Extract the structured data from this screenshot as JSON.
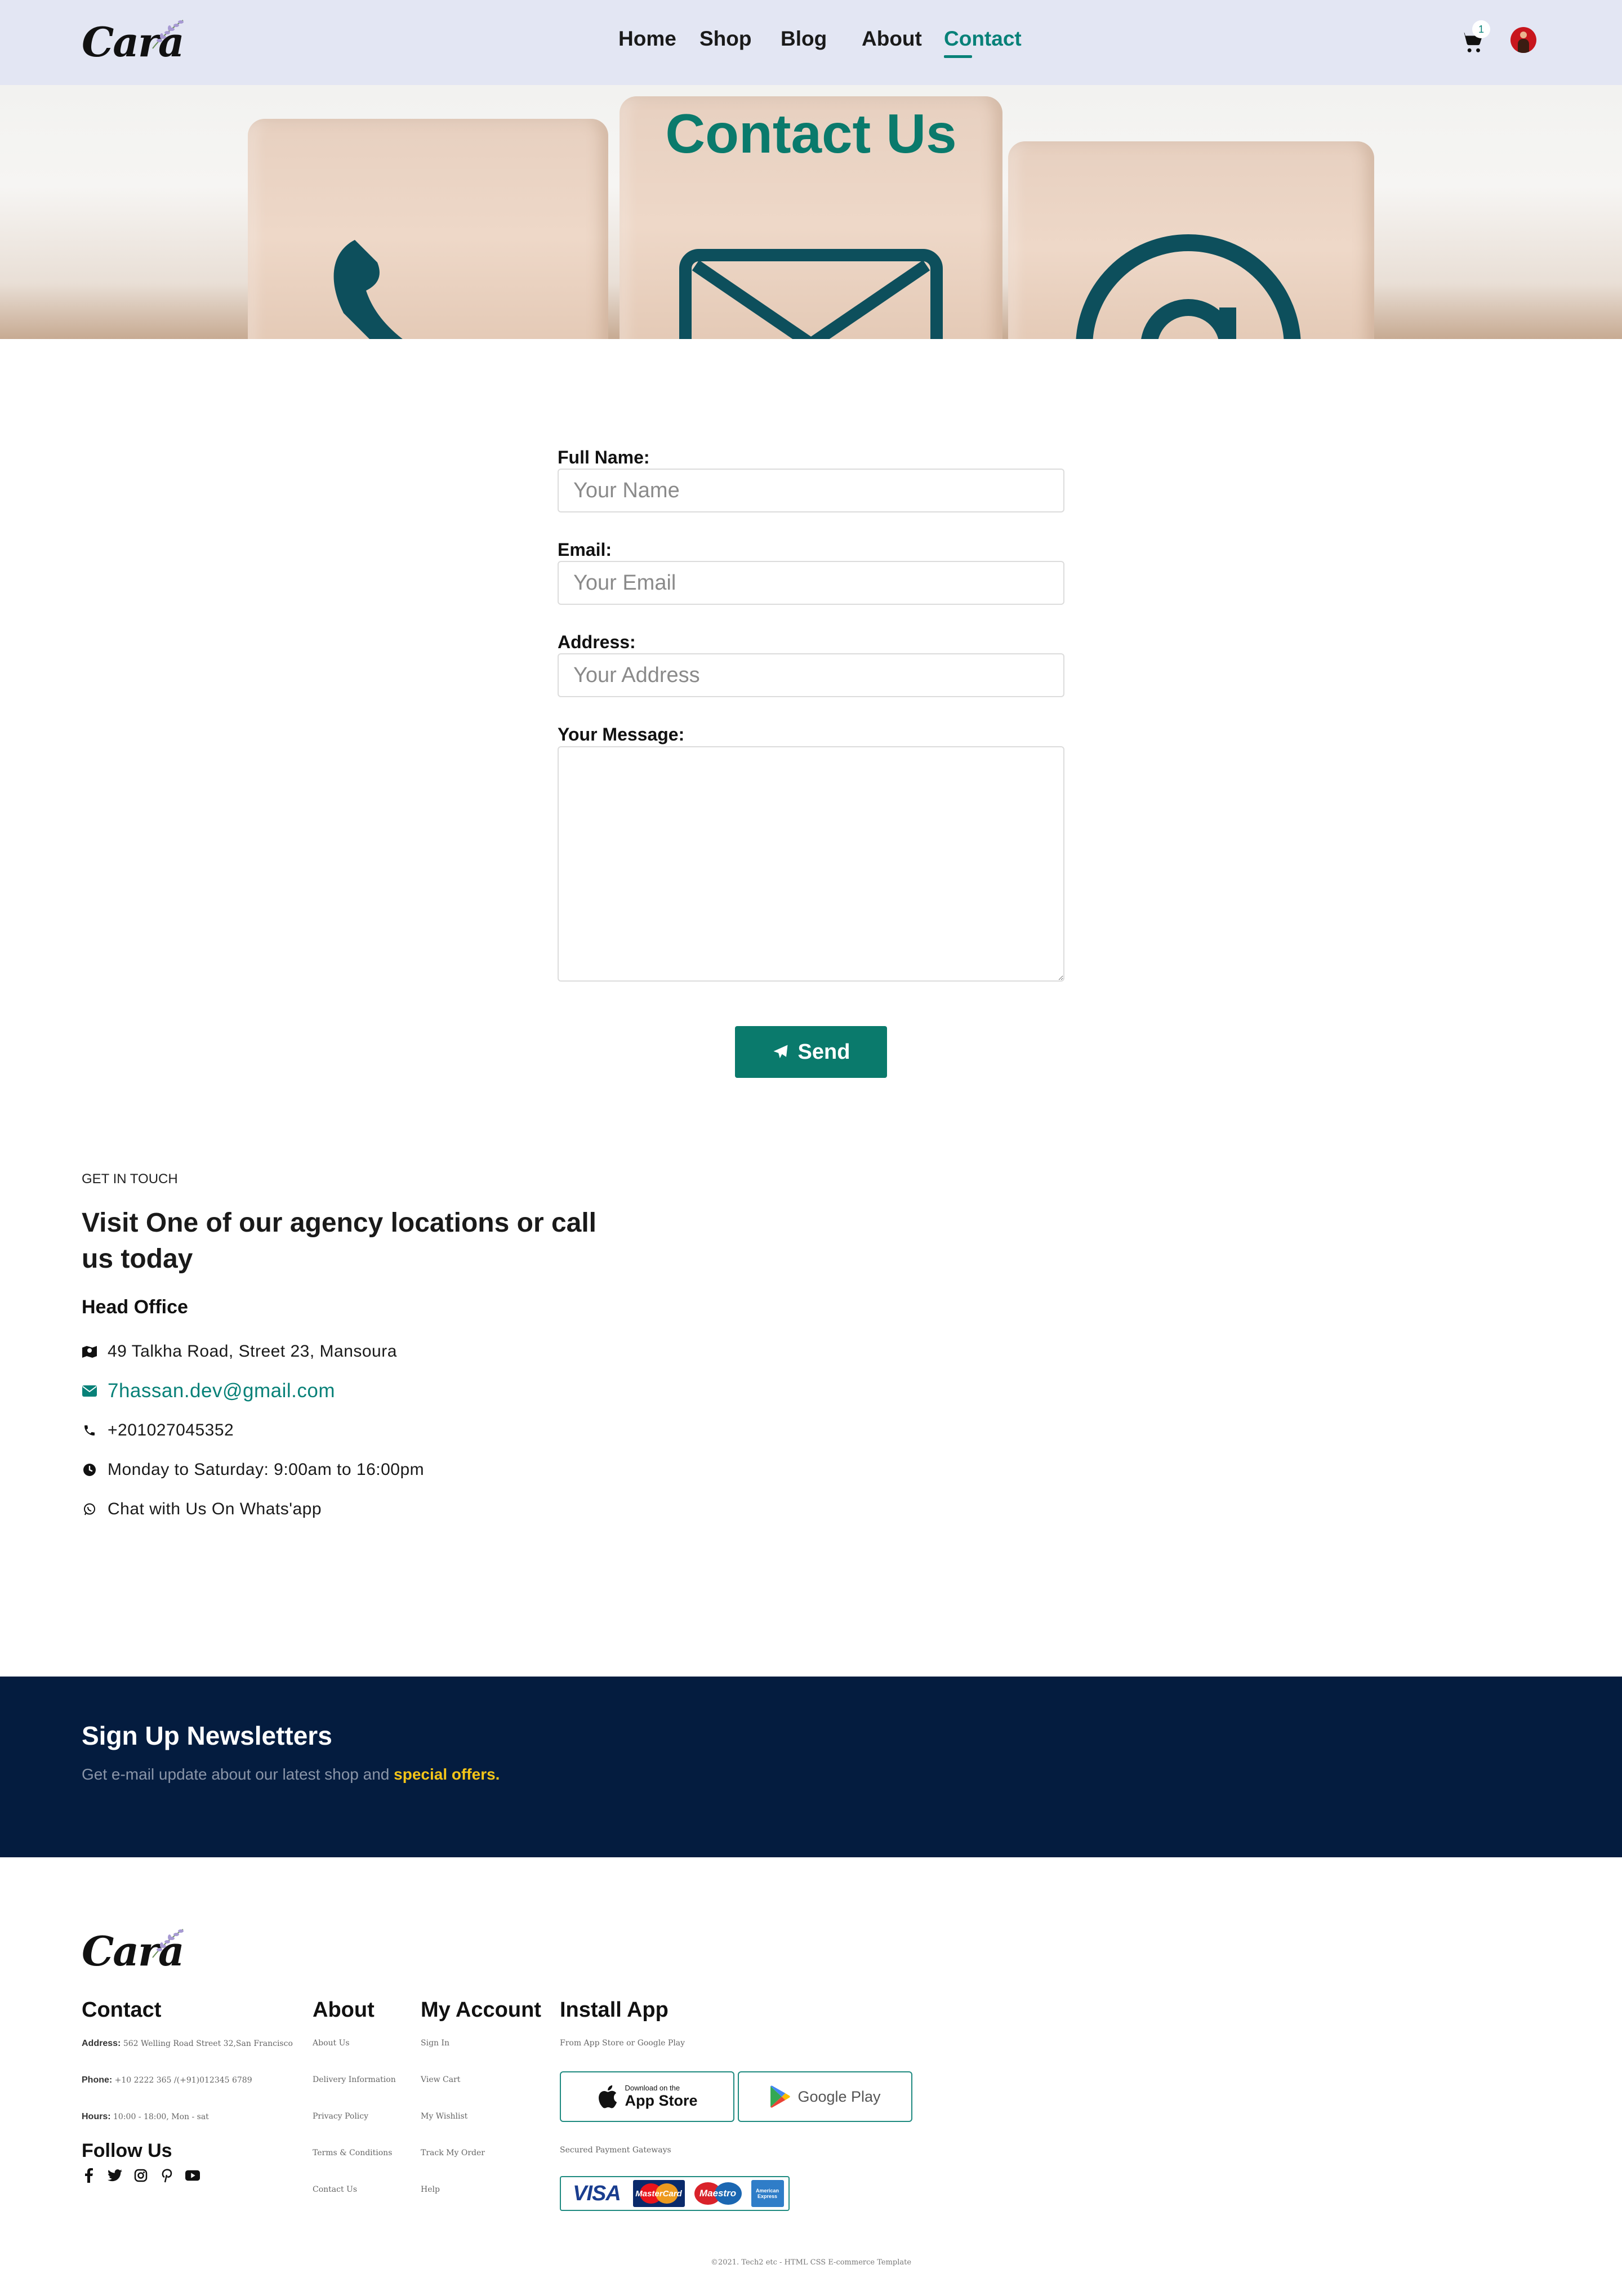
{
  "header": {
    "logo_text": "Cara",
    "nav": [
      {
        "label": "Home",
        "active": false
      },
      {
        "label": "Shop",
        "active": false
      },
      {
        "label": "Blog",
        "active": false
      },
      {
        "label": "About",
        "active": false
      },
      {
        "label": "Contact",
        "active": true
      }
    ],
    "cart_count": "1",
    "accent_color": "#088178",
    "background_color": "#e3e6f3"
  },
  "hero": {
    "title": "Contact Us",
    "icons": [
      "phone-icon",
      "envelope-icon",
      "at-sign-icon"
    ]
  },
  "form": {
    "full_name_label": "Full Name:",
    "full_name_placeholder": "Your Name",
    "email_label": "Email:",
    "email_placeholder": "Your Email",
    "address_label": "Address:",
    "address_placeholder": "Your Address",
    "message_label": "Your Message:",
    "send_label": "Send",
    "send_icon": "paper-plane-icon"
  },
  "contact_info": {
    "eyebrow": "GET IN TOUCH",
    "title": "Visit One of our agency locations or call us today",
    "office_heading": "Head Office",
    "items": [
      {
        "icon": "map-icon",
        "text": "49 Talkha Road, Street 23, Mansoura",
        "link": false
      },
      {
        "icon": "envelope-icon",
        "text": "7hassan.dev@gmail.com",
        "link": true
      },
      {
        "icon": "phone-icon",
        "text": "+201027045352",
        "link": false
      },
      {
        "icon": "clock-icon",
        "text": "Monday to Saturday: 9:00am to 16:00pm",
        "link": false
      },
      {
        "icon": "whatsapp-icon",
        "text": "Chat with Us On Whats'app",
        "link": false
      }
    ]
  },
  "newsletter": {
    "title": "Sign Up Newsletters",
    "subtitle": "Get e-mail update about our latest shop and",
    "highlight": "special offers.",
    "background_color": "#041c3f",
    "highlight_color": "#f5c518"
  },
  "footer": {
    "logo_text": "Cara",
    "contact": {
      "heading": "Contact",
      "address_label": "Address:",
      "address_value": "562 Welling Road Street 32,San Francisco",
      "phone_label": "Phone:",
      "phone_value": "+10 2222 365 /(+91)012345 6789",
      "hours_label": "Hours:",
      "hours_value": "10:00 - 18:00, Mon - sat"
    },
    "follow_heading": "Follow Us",
    "social_icons": [
      "facebook-icon",
      "twitter-icon",
      "instagram-icon",
      "pinterest-icon",
      "youtube-icon"
    ],
    "about": {
      "heading": "About",
      "links": [
        "About Us",
        "Delivery Information",
        "Privacy Policy",
        "Terms & Conditions",
        "Contact Us"
      ]
    },
    "account": {
      "heading": "My Account",
      "links": [
        "Sign In",
        "View Cart",
        "My Wishlist",
        "Track My Order",
        "Help"
      ]
    },
    "install": {
      "heading": "Install App",
      "subtitle": "From App Store or Google Play",
      "app_store_small": "Download on the",
      "app_store_big": "App Store",
      "google_play": "Google Play",
      "payment_label": "Secured Payment Gateways",
      "payment_cards": [
        "VISA",
        "MasterCard",
        "Maestro",
        "American Express"
      ]
    },
    "copyright": "©2021. Tech2 etc - HTML CSS E-commerce Template"
  }
}
